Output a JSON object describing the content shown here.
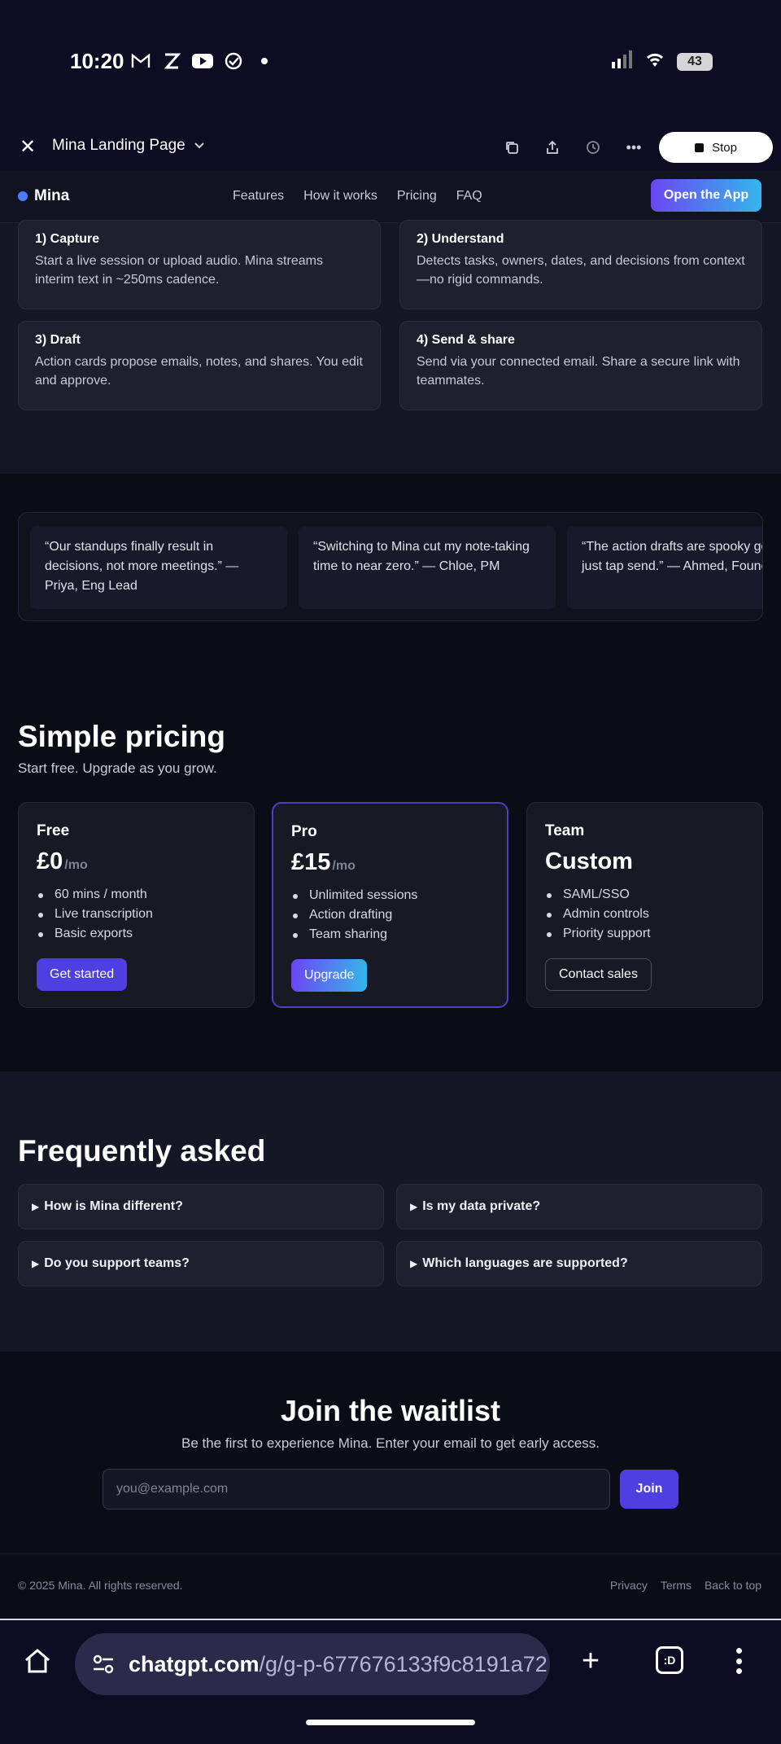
{
  "status_bar": {
    "time": "10:20",
    "battery": "43"
  },
  "canvas_bar": {
    "title": "Mina Landing Page",
    "stop_label": "Stop"
  },
  "nav": {
    "brand": "Mina",
    "links": [
      "Features",
      "How it works",
      "Pricing",
      "FAQ"
    ],
    "cta": "Open the App"
  },
  "steps": [
    {
      "title": "1) Capture",
      "body": "Start a live session or upload audio. Mina streams interim text in ~250ms cadence."
    },
    {
      "title": "2) Understand",
      "body": "Detects tasks, owners, dates, and decisions from context—no rigid commands."
    },
    {
      "title": "3) Draft",
      "body": "Action cards propose emails, notes, and shares. You edit and approve."
    },
    {
      "title": "4) Send & share",
      "body": "Send via your connected email. Share a secure link with teammates."
    }
  ],
  "testimonials": [
    "“Our standups finally result in decisions, not more meetings.” — Priya, Eng Lead",
    "“Switching to Mina cut my note-taking time to near zero.” — Chloe, PM",
    "“The action drafts are spooky good — I just tap send.” — Ahmed, Founder"
  ],
  "pricing": {
    "title": "Simple pricing",
    "subtitle": "Start free. Upgrade as you grow.",
    "plans": [
      {
        "name": "Free",
        "price": "£0",
        "per": "/mo",
        "features": [
          "60 mins / month",
          "Live transcription",
          "Basic exports"
        ],
        "cta": "Get started"
      },
      {
        "name": "Pro",
        "price": "£15",
        "per": "/mo",
        "features": [
          "Unlimited sessions",
          "Action drafting",
          "Team sharing"
        ],
        "cta": "Upgrade"
      },
      {
        "name": "Team",
        "price": "Custom",
        "per": "",
        "features": [
          "SAML/SSO",
          "Admin controls",
          "Priority support"
        ],
        "cta": "Contact sales"
      }
    ]
  },
  "faq": {
    "title": "Frequently asked",
    "items": [
      "How is Mina different?",
      "Is my data private?",
      "Do you support teams?",
      "Which languages are supported?"
    ]
  },
  "waitlist": {
    "title": "Join the waitlist",
    "subtitle": "Be the first to experience Mina. Enter your email to get early access.",
    "placeholder": "you@example.com",
    "button": "Join"
  },
  "footer": {
    "copyright": "© 2025 Mina. All rights reserved.",
    "links": [
      "Privacy",
      "Terms",
      "Back to top"
    ]
  },
  "browser": {
    "url_domain": "chatgpt.com",
    "url_path": "/g/g-p-677676133f9c8191a72",
    "tabs_label": ":D"
  }
}
